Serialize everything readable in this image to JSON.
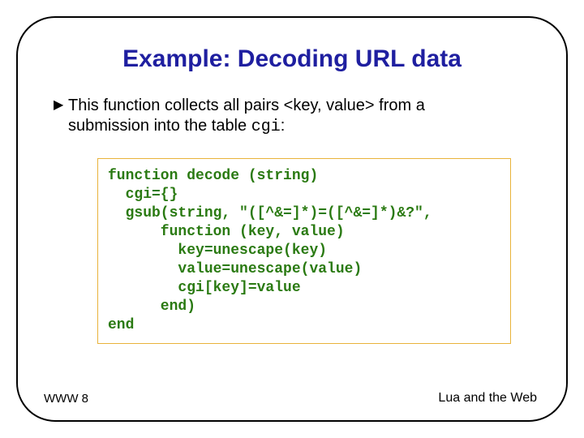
{
  "title": "Example: Decoding URL data",
  "bullet_glyph": "▶",
  "body": {
    "line1a": "This function collects all pairs <key, value> from a",
    "line2a": "submission into the table ",
    "line2_code": "cgi",
    "line2b": ":"
  },
  "code": "function decode (string)\n  cgi={}\n  gsub(string, \"([^&=]*)=([^&=]*)&?\",\n      function (key, value)\n        key=unescape(key)\n        value=unescape(value)\n        cgi[key]=value\n      end)\nend",
  "footer_left": "WWW 8",
  "footer_right": "Lua and the Web"
}
